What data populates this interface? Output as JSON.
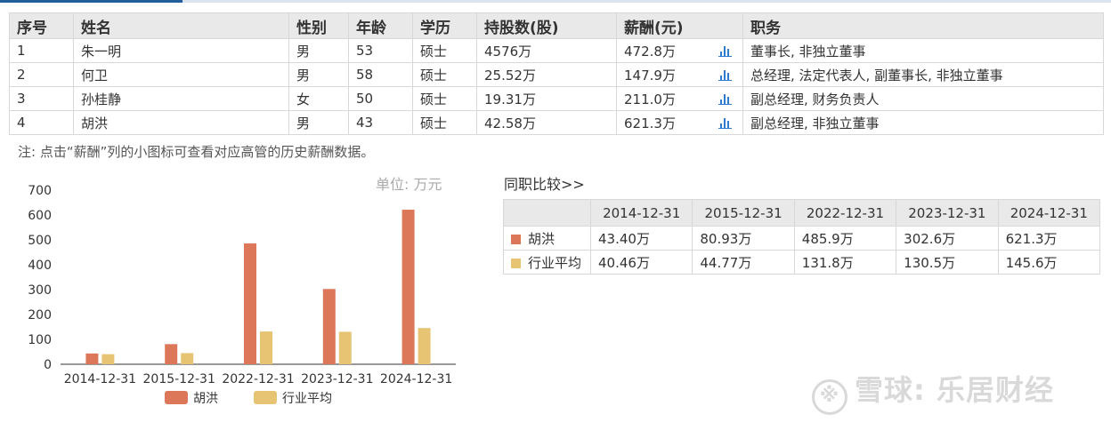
{
  "exec_table": {
    "headers": [
      "序号",
      "姓名",
      "性别",
      "年龄",
      "学历",
      "持股数(股)",
      "薪酬(元)",
      "职务"
    ],
    "rows": [
      {
        "no": "1",
        "name": "朱一明",
        "gender": "男",
        "age": "53",
        "edu": "硕士",
        "shares": "4576万",
        "salary": "472.8万",
        "title": "董事长, 非独立董事"
      },
      {
        "no": "2",
        "name": "何卫",
        "gender": "男",
        "age": "58",
        "edu": "硕士",
        "shares": "25.52万",
        "salary": "147.9万",
        "title": "总经理, 法定代表人, 副董事长, 非独立董事"
      },
      {
        "no": "3",
        "name": "孙桂静",
        "gender": "女",
        "age": "50",
        "edu": "硕士",
        "shares": "19.31万",
        "salary": "211.0万",
        "title": "副总经理, 财务负责人"
      },
      {
        "no": "4",
        "name": "胡洪",
        "gender": "男",
        "age": "43",
        "edu": "硕士",
        "shares": "42.58万",
        "salary": "621.3万",
        "title": "副总经理, 非独立董事"
      }
    ]
  },
  "note": "注: 点击“薪酬”列的小图标可查看对应高管的历史薪酬数据。",
  "unit_label": "单位: 万元",
  "compare": {
    "title": "同职比较>>",
    "years": [
      "2014-12-31",
      "2015-12-31",
      "2022-12-31",
      "2023-12-31",
      "2024-12-31"
    ],
    "rows": [
      {
        "label": "胡洪",
        "color": "#dd7759",
        "values": [
          "43.40万",
          "80.93万",
          "485.9万",
          "302.6万",
          "621.3万"
        ]
      },
      {
        "label": "行业平均",
        "color": "#e6c474",
        "values": [
          "40.46万",
          "44.77万",
          "131.8万",
          "130.5万",
          "145.6万"
        ]
      }
    ]
  },
  "chart_data": {
    "type": "bar",
    "categories": [
      "2014-12-31",
      "2015-12-31",
      "2022-12-31",
      "2023-12-31",
      "2024-12-31"
    ],
    "series": [
      {
        "name": "胡洪",
        "color": "#dd7759",
        "values": [
          43.4,
          80.93,
          485.9,
          302.6,
          621.3
        ]
      },
      {
        "name": "行业平均",
        "color": "#e6c474",
        "values": [
          40.46,
          44.77,
          131.8,
          130.5,
          145.6
        ]
      }
    ],
    "yticks": [
      0,
      100,
      200,
      300,
      400,
      500,
      600,
      700
    ],
    "ylim": [
      0,
      700
    ],
    "legend": "bottom"
  },
  "watermark": {
    "text": "雪球: 乐居财经",
    "icon": "snowball-logo-icon"
  }
}
